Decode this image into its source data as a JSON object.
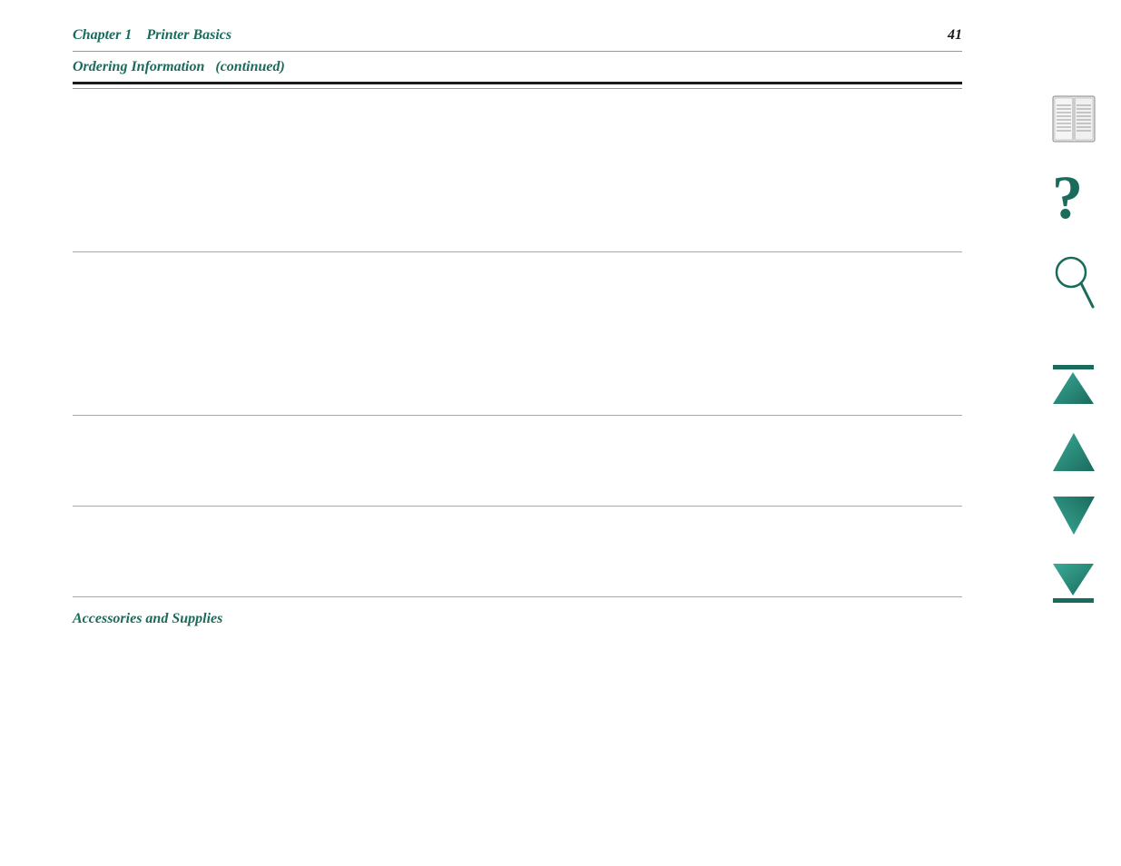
{
  "header": {
    "chapter_text": "Chapter 1",
    "chapter_subtitle": "Printer Basics",
    "page_number": "41"
  },
  "section": {
    "title": "Ordering Information",
    "continued": "(continued)"
  },
  "footer": {
    "label": "Accessories and Supplies"
  },
  "sidebar": {
    "book_icon_label": "book-icon",
    "help_icon_label": "help-icon",
    "search_icon_label": "search-icon",
    "first_page_icon_label": "first-page-icon",
    "prev_page_icon_label": "prev-page-icon",
    "next_page_icon_label": "next-page-icon",
    "last_page_icon_label": "last-page-icon"
  },
  "colors": {
    "teal": "#1a6b5c",
    "teal_mid": "#2a8a78",
    "teal_light": "#3aaa98"
  }
}
